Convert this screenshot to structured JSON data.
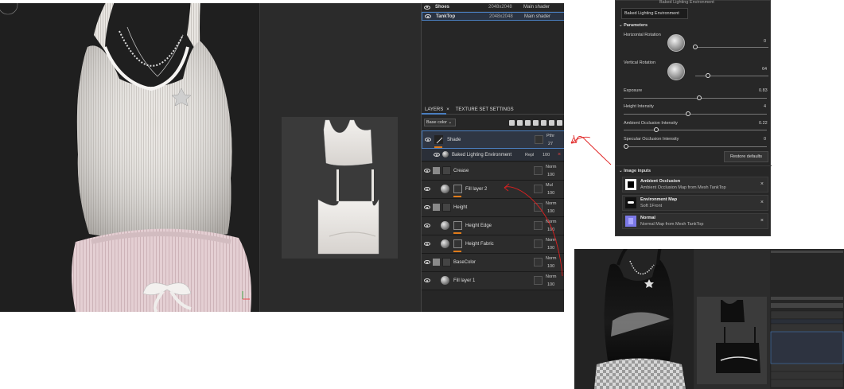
{
  "texture_sets": [
    {
      "name": "Shoes",
      "size": "2048x2048",
      "shader": "Main shader"
    },
    {
      "name": "TankTop",
      "size": "2048x2048",
      "shader": "Main shader"
    }
  ],
  "tabs": {
    "layers": "LAYERS",
    "close": "×",
    "texture_set_settings": "TEXTURE SET SETTINGS"
  },
  "channel_dropdown": "Base color ⌄",
  "layers": [
    {
      "name": "Shade",
      "blend": "Pthr",
      "opacity": "27"
    },
    {
      "name": "Baked Lighting Environment",
      "blend": "Repl",
      "opacity": "100"
    },
    {
      "name": "Crease",
      "blend": "Norm",
      "opacity": "100"
    },
    {
      "name": "Fill layer 2",
      "blend": "Mul",
      "opacity": "100"
    },
    {
      "name": "Height",
      "blend": "Norm",
      "opacity": "100"
    },
    {
      "name": "Height Edge",
      "blend": "Norm",
      "opacity": "100"
    },
    {
      "name": "Height Fabric",
      "blend": "Norm",
      "opacity": "100"
    },
    {
      "name": "BaseColor",
      "blend": "Norm",
      "opacity": "100"
    },
    {
      "name": "Fill layer 1",
      "blend": "Norm",
      "opacity": "100"
    }
  ],
  "params": {
    "header": "Baked Lighting Environment",
    "tooltip": "Baked Lighting Environment",
    "section": "Parameters",
    "h_rot": {
      "label": "Horizontal Rotation",
      "value": "0"
    },
    "v_rot": {
      "label": "Vertical Rotation",
      "value": "64"
    },
    "exposure": {
      "label": "Exposure",
      "value": "0.83",
      "fill": 0.53
    },
    "height": {
      "label": "Height Intensity",
      "value": "4",
      "fill": 0.45
    },
    "ao": {
      "label": "Ambient Occlusion Intensity",
      "value": "0.22",
      "fill": 0.22
    },
    "spec": {
      "label": "Specular Occlusion Intensity",
      "value": "0",
      "fill": 0.0
    },
    "restore": "Restore defaults",
    "image_inputs": "Image inputs",
    "inputs": [
      {
        "title": "Ambient Occlusion",
        "sub": "Ambient Occlusion Map from Mesh TankTop"
      },
      {
        "title": "Environment Map",
        "sub": "Soft 1Front"
      },
      {
        "title": "Normal",
        "sub": "Normal Map from Mesh TankTop"
      }
    ]
  },
  "colors": {
    "accent": "#4a7fc0",
    "orange": "#e07b1a",
    "arrow": "#e02020"
  }
}
